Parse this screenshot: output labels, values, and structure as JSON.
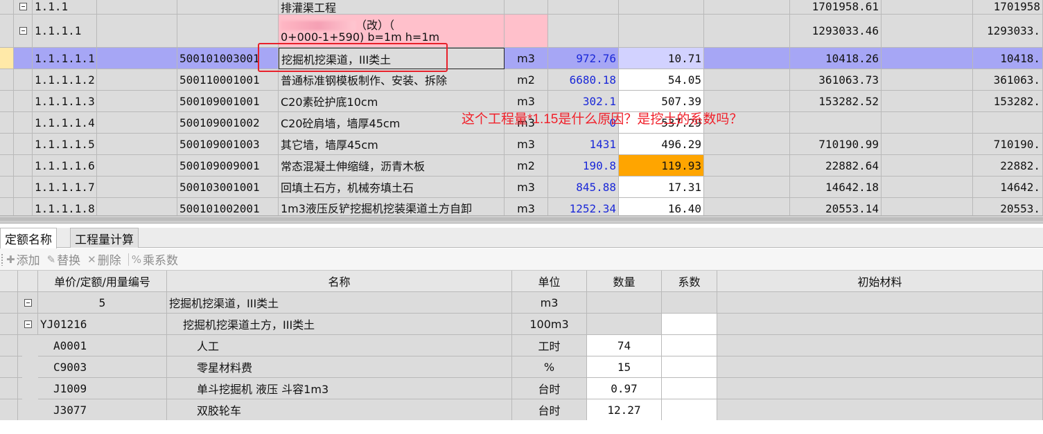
{
  "top_grid": {
    "rows": [
      {
        "expand": true,
        "code": "1.1.1",
        "item": "",
        "name": "排灌渠工程",
        "unit": "",
        "qty": "",
        "price": "",
        "total": "1701958.61",
        "total2": "1701958",
        "style": "group"
      },
      {
        "expand": true,
        "code": "1.1.1.1",
        "item": "",
        "name_line1": "（改）（",
        "name_line2": "0+000-1+590)  b=1m   h=1m",
        "unit": "",
        "qty": "",
        "price": "",
        "total": "1293033.46",
        "total2": "1293033.",
        "style": "pink"
      },
      {
        "expand": false,
        "code": "1.1.1.1.1",
        "item": "500101003001",
        "name": "挖掘机挖渠道，III类土",
        "unit": "m3",
        "qty": "972.76",
        "price": "10.71",
        "total": "10418.26",
        "total2": "10418.",
        "style": "selected"
      },
      {
        "expand": false,
        "code": "1.1.1.1.2",
        "item": "500110001001",
        "name": "普通标准钢模板制作、安装、拆除",
        "unit": "m2",
        "qty": "6680.18",
        "price": "54.05",
        "total": "361063.73",
        "total2": "361063.",
        "style": "normal"
      },
      {
        "expand": false,
        "code": "1.1.1.1.3",
        "item": "500109001001",
        "name": "C20素砼护底10cm",
        "unit": "m3",
        "qty": "302.1",
        "price": "507.39",
        "total": "153282.52",
        "total2": "153282.",
        "style": "normal"
      },
      {
        "expand": false,
        "code": "1.1.1.1.4",
        "item": "500109001002",
        "name": "C20砼肩墙，墙厚45cm",
        "unit": "m3",
        "qty": "0",
        "price": "537.29",
        "total": "",
        "total2": "",
        "style": "normal"
      },
      {
        "expand": false,
        "code": "1.1.1.1.5",
        "item": "500109001003",
        "name": "其它墙，墙厚45cm",
        "unit": "m3",
        "qty": "1431",
        "price": "496.29",
        "total": "710190.99",
        "total2": "710190.",
        "style": "normal"
      },
      {
        "expand": false,
        "code": "1.1.1.1.6",
        "item": "500109009001",
        "name": "常态混凝土伸缩缝，沥青木板",
        "unit": "m2",
        "qty": "190.8",
        "price": "119.93",
        "total": "22882.64",
        "total2": "22882.",
        "style": "orange"
      },
      {
        "expand": false,
        "code": "1.1.1.1.7",
        "item": "500103001001",
        "name": "回填土石方，机械夯填土石",
        "unit": "m3",
        "qty": "845.88",
        "price": "17.31",
        "total": "14642.18",
        "total2": "14642.",
        "style": "normal"
      },
      {
        "expand": false,
        "code": "1.1.1.1.8",
        "item": "500101002001",
        "name": "1m3液压反铲挖掘机挖装渠道土方自卸",
        "unit": "m3",
        "qty": "1252.34",
        "price": "16.40",
        "total": "20553.14",
        "total2": "20553.",
        "style": "cut"
      }
    ]
  },
  "annotation": {
    "text": "这个工程量*1.15是什么原因？是挖土的系数吗？",
    "color": "#f0202a"
  },
  "tabs": [
    {
      "label": "定额名称",
      "active": true
    },
    {
      "label": "工程量计算",
      "active": false
    }
  ],
  "toolbar": {
    "add": "添加",
    "replace": "替换",
    "delete": "删除",
    "multiply": "乘系数"
  },
  "bottom_grid": {
    "headers": [
      "单价/定额/用量编号",
      "名称",
      "单位",
      "数量",
      "系数",
      "初始材料"
    ],
    "rows": [
      {
        "expand": true,
        "code": "5",
        "name": "挖掘机挖渠道，III类土",
        "unit": "m3",
        "qty": "",
        "coef": "",
        "level": 0,
        "center_code": true
      },
      {
        "expand": true,
        "code": "YJ01216",
        "name": "挖掘机挖渠道土方，III类土",
        "unit": "100m3",
        "qty": "",
        "coef": "",
        "level": 1,
        "center_code": false
      },
      {
        "expand": false,
        "code": "A0001",
        "name": "人工",
        "unit": "工时",
        "qty": "74",
        "coef": "",
        "level": 2,
        "center_code": false
      },
      {
        "expand": false,
        "code": "C9003",
        "name": "零星材料费",
        "unit": "%",
        "qty": "15",
        "coef": "",
        "level": 2,
        "center_code": false
      },
      {
        "expand": false,
        "code": "J1009",
        "name": "单斗挖掘机 液压 斗容1m3",
        "unit": "台时",
        "qty": "0.97",
        "coef": "",
        "level": 2,
        "center_code": false
      },
      {
        "expand": false,
        "code": "J3077",
        "name": "双胶轮车",
        "unit": "台时",
        "qty": "12.27",
        "coef": "",
        "level": 2,
        "center_code": false
      }
    ]
  },
  "colors": {
    "selected_row": "#a6a6f5",
    "pink_row": "#ffc0cb",
    "highlight_cell": "#ffa500",
    "qty_text": "#1a28d8"
  }
}
